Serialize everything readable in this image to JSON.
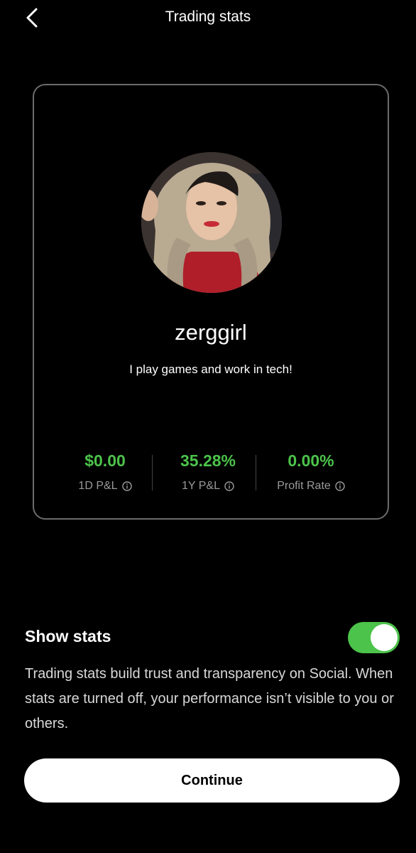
{
  "header": {
    "title": "Trading stats",
    "back_icon": "chevron-left-icon"
  },
  "profile": {
    "username": "zerggirl",
    "bio": "I play games and work in tech!",
    "avatar": "profile-photo"
  },
  "stats": [
    {
      "value": "$0.00",
      "label": "1D P&L",
      "icon": "info-icon"
    },
    {
      "value": "35.28%",
      "label": "1Y P&L",
      "icon": "info-icon"
    },
    {
      "value": "0.00%",
      "label": "Profit Rate",
      "icon": "info-icon"
    }
  ],
  "settings": {
    "show_stats_label": "Show stats",
    "show_stats_enabled": true,
    "description": "Trading stats build trust and transparency on Social. When stats are turned off, your performance isn’t visible to you or others."
  },
  "footer": {
    "continue_label": "Continue"
  },
  "colors": {
    "background": "#000000",
    "positive": "#4cc34a",
    "toggle_on": "#4cc34a",
    "button": "#ffffff"
  }
}
